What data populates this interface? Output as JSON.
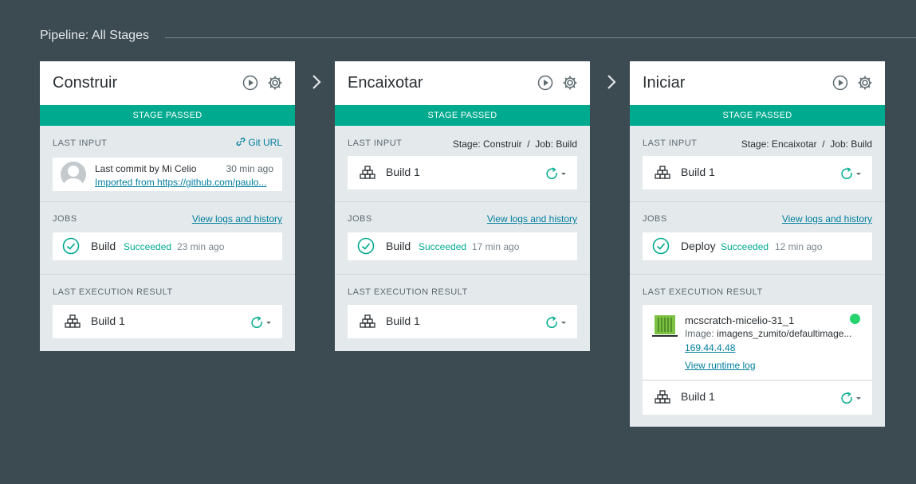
{
  "header": {
    "title": "Pipeline: All Stages"
  },
  "icons": {
    "play": "play-icon",
    "gear": "gear-icon",
    "build": "build-stack-icon",
    "redeploy": "redeploy-icon",
    "check": "check-circle-icon",
    "container": "container-icon",
    "link": "link-icon",
    "arrow": "chevron-right-icon"
  },
  "colors": {
    "accent": "#00aa8f",
    "link": "#007f9e",
    "background": "#3c4a52",
    "status_dot": "#27d36c"
  },
  "stages": [
    {
      "name": "Construir",
      "status": "STAGE PASSED",
      "last_input": {
        "label": "LAST INPUT",
        "link_text": "Git URL",
        "commit_title": "Last commit by Mi Celio",
        "commit_time": "30 min ago",
        "commit_message": "Imported from https://github.com/paulo..."
      },
      "jobs": {
        "label": "JOBS",
        "link": "View logs and history",
        "job_name": "Build",
        "job_status": "Succeeded",
        "job_time": "23 min ago"
      },
      "last_execution": {
        "label": "LAST EXECUTION RESULT",
        "build": "Build 1"
      }
    },
    {
      "name": "Encaixotar",
      "status": "STAGE PASSED",
      "last_input": {
        "label": "LAST INPUT",
        "meta": "Stage: Construir  /  Job: Build",
        "build": "Build 1"
      },
      "jobs": {
        "label": "JOBS",
        "link": "View logs and history",
        "job_name": "Build",
        "job_status": "Succeeded",
        "job_time": "17 min ago"
      },
      "last_execution": {
        "label": "LAST EXECUTION RESULT",
        "build": "Build 1"
      }
    },
    {
      "name": "Iniciar",
      "status": "STAGE PASSED",
      "last_input": {
        "label": "LAST INPUT",
        "meta": "Stage: Encaixotar  /  Job: Build",
        "build": "Build 1"
      },
      "jobs": {
        "label": "JOBS",
        "link": "View logs and history",
        "job_name": "Deploy",
        "job_status": "Succeeded",
        "job_time": "12 min ago"
      },
      "last_execution": {
        "label": "LAST EXECUTION RESULT",
        "container_name": "mcscratch-micelio-31_1",
        "image_label": "Image:",
        "image_value": "imagens_zumito/defaultimage...",
        "ip": "169.44.4.48",
        "runtime_link": "View runtime log",
        "build": "Build 1"
      }
    }
  ]
}
